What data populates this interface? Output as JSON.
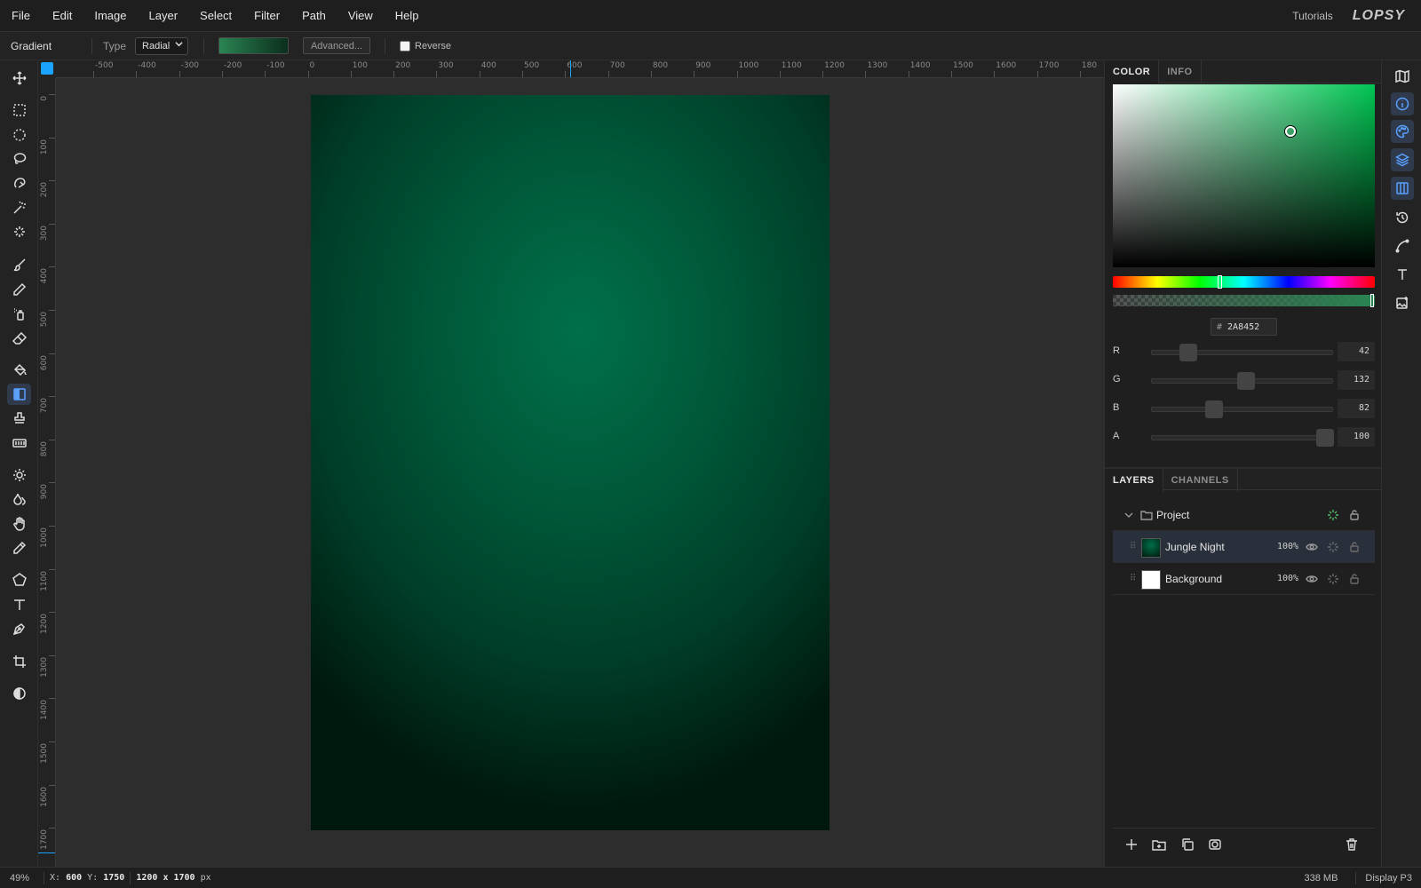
{
  "menubar": {
    "items": [
      "File",
      "Edit",
      "Image",
      "Layer",
      "Select",
      "Filter",
      "Path",
      "View",
      "Help"
    ],
    "tutorials": "Tutorials",
    "logo": "LOPSY"
  },
  "options": {
    "tool_name": "Gradient",
    "type_label": "Type",
    "type_value": "Radial",
    "advanced_label": "Advanced...",
    "reverse_label": "Reverse",
    "reverse_checked": false,
    "gradient_colors": [
      "#2a8452",
      "#0b2e1d"
    ]
  },
  "toolbar": {
    "tools": [
      "move-icon",
      "rect-select-icon",
      "ellipse-select-icon",
      "lasso-icon",
      "magnetic-lasso-icon",
      "magic-wand-icon",
      "quick-select-icon",
      "brush-icon",
      "pencil-icon",
      "spray-icon",
      "eraser-icon",
      "paint-bucket-icon",
      "gradient-icon",
      "stamp-icon",
      "pattern-icon",
      "dodge-icon",
      "blur-icon",
      "smudge-icon",
      "eyedropper-icon",
      "shape-icon",
      "text-icon",
      "pen-icon",
      "crop-icon",
      "contrast-icon"
    ],
    "active_tool": "gradient-icon"
  },
  "rulers": {
    "horizontal": [
      "-500",
      "-400",
      "-300",
      "-200",
      "-100",
      "0",
      "100",
      "200",
      "300",
      "400",
      "500",
      "600",
      "700",
      "800",
      "900",
      "1000",
      "1100",
      "1200",
      "1300",
      "1400",
      "1500",
      "1600",
      "1700",
      "180"
    ],
    "vertical": [
      "0",
      "100",
      "200",
      "300",
      "400",
      "500",
      "600",
      "700",
      "800",
      "900",
      "1000",
      "1100",
      "1200",
      "1300",
      "1400",
      "1500",
      "1600",
      "1700"
    ]
  },
  "color_panel": {
    "tabs": [
      "COLOR",
      "INFO"
    ],
    "active_tab": "COLOR",
    "hex_prefix": "#",
    "hex": "2A8452",
    "channels": [
      {
        "label": "R",
        "value": "42",
        "fraction": 0.165
      },
      {
        "label": "G",
        "value": "132",
        "fraction": 0.518
      },
      {
        "label": "B",
        "value": "82",
        "fraction": 0.322
      },
      {
        "label": "A",
        "value": "100",
        "fraction": 1.0
      }
    ],
    "accent": "#2a8452"
  },
  "layers_panel": {
    "tabs": [
      "LAYERS",
      "CHANNELS"
    ],
    "active_tab": "LAYERS",
    "group": {
      "name": "Project"
    },
    "layers": [
      {
        "name": "Jungle Night",
        "opacity": "100%",
        "selected": true
      },
      {
        "name": "Background",
        "opacity": "100%",
        "selected": false
      }
    ]
  },
  "status": {
    "zoom": "49%",
    "x_label": "X:",
    "x_value": "600",
    "y_label": "Y:",
    "y_value": "1750",
    "doc_size": "1200 x 1700",
    "doc_unit": "px",
    "memory": "338 MB",
    "color_profile": "Display P3"
  }
}
